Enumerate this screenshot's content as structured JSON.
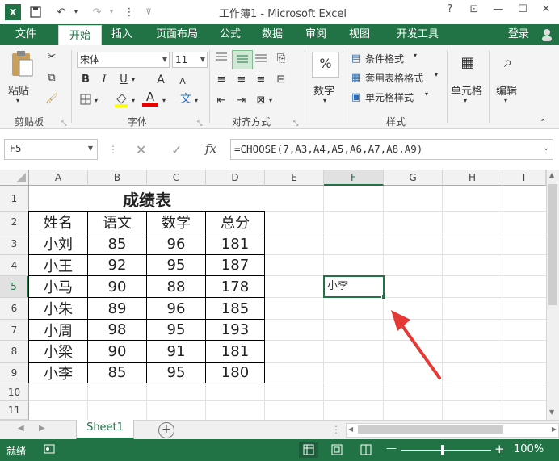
{
  "title_bar": {
    "title": "工作簿1 - Microsoft Excel",
    "help": "?",
    "ribbon_display": "⊡",
    "minimize": "—",
    "maximize": "☐",
    "close": "✕"
  },
  "ribbon_tabs": [
    {
      "label": "文件"
    },
    {
      "label": "开始"
    },
    {
      "label": "插入"
    },
    {
      "label": "页面布局"
    },
    {
      "label": "公式"
    },
    {
      "label": "数据"
    },
    {
      "label": "审阅"
    },
    {
      "label": "视图"
    },
    {
      "label": "开发工具"
    }
  ],
  "login": "登录",
  "clipboard": {
    "paste": "粘贴",
    "group": "剪贴板"
  },
  "font": {
    "name": "宋体",
    "size": "11",
    "bold": "B",
    "italic": "I",
    "underline": "U",
    "grow": "A",
    "shrink": "A",
    "color_a": "A",
    "wen": "文",
    "group": "字体"
  },
  "alignment": {
    "group": "对齐方式"
  },
  "number": {
    "percent": "%",
    "label": "数字"
  },
  "styles": {
    "conditional": "条件格式",
    "table": "套用表格格式",
    "cell": "单元格样式",
    "group": "样式"
  },
  "cells": {
    "label": "单元格"
  },
  "editing": {
    "label": "编辑"
  },
  "formula_bar": {
    "name_box": "F5",
    "cancel": "✕",
    "enter": "✓",
    "fx": "fx",
    "formula": "=CHOOSE(7,A3,A4,A5,A6,A7,A8,A9)"
  },
  "columns": [
    "A",
    "B",
    "C",
    "D",
    "E",
    "F",
    "G",
    "H",
    "I"
  ],
  "rows": [
    "1",
    "2",
    "3",
    "4",
    "5",
    "6",
    "7",
    "8",
    "9",
    "10",
    "11"
  ],
  "sheet": {
    "title": "成绩表",
    "headers": [
      "姓名",
      "语文",
      "数学",
      "总分"
    ],
    "data": [
      [
        "小刘",
        "85",
        "96",
        "181"
      ],
      [
        "小王",
        "92",
        "95",
        "187"
      ],
      [
        "小马",
        "90",
        "88",
        "178"
      ],
      [
        "小朱",
        "89",
        "96",
        "185"
      ],
      [
        "小周",
        "98",
        "95",
        "193"
      ],
      [
        "小梁",
        "90",
        "91",
        "181"
      ],
      [
        "小李",
        "85",
        "95",
        "180"
      ]
    ],
    "f5_value": "小李"
  },
  "sheet_tabs": {
    "active": "Sheet1",
    "add": "+"
  },
  "status_bar": {
    "ready": "就绪",
    "zoom": "100%",
    "minus": "—",
    "plus": "+"
  },
  "colors": {
    "accent": "#217346",
    "arrow": "#e53935"
  }
}
